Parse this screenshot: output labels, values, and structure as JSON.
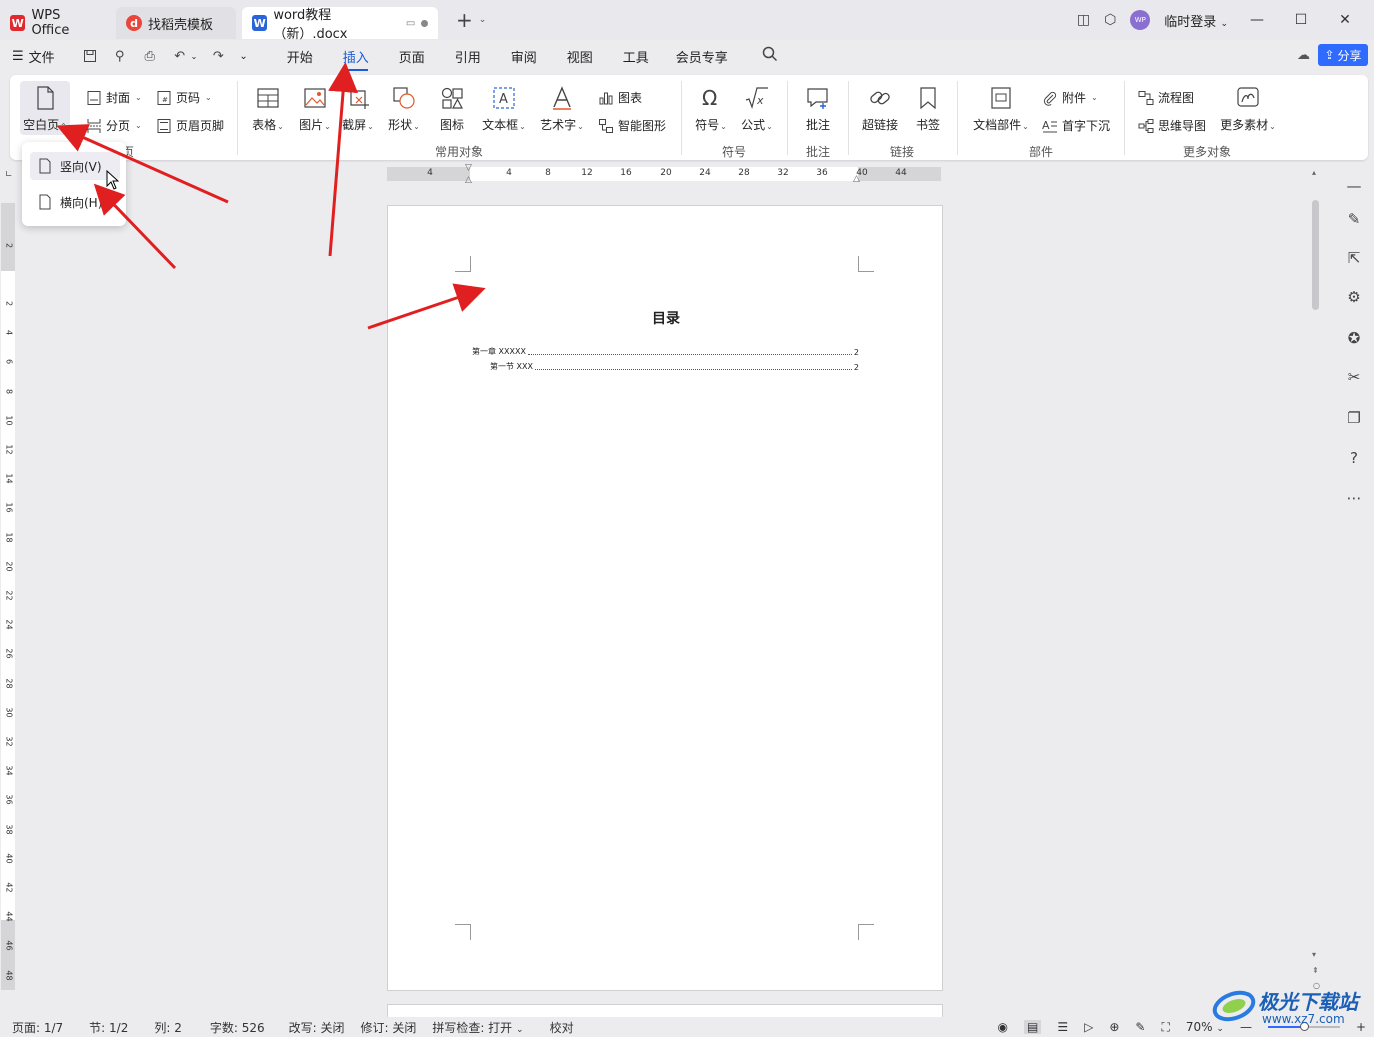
{
  "titlebar": {
    "tabs": [
      {
        "label": "WPS Office"
      },
      {
        "label": "找稻壳模板"
      },
      {
        "label": "word教程（新）.docx"
      }
    ],
    "new_tab": "+",
    "user": "临时登录",
    "avatar_text": "WP"
  },
  "menubar": {
    "file_label": "文件",
    "tabs": [
      "开始",
      "插入",
      "页面",
      "引用",
      "审阅",
      "视图",
      "工具",
      "会员专享"
    ],
    "active_tab": "插入",
    "share_label": "分享"
  },
  "ribbon": {
    "blank_page": "空白页",
    "cover": "封面",
    "page_number": "页码",
    "page_break": "分页",
    "header_footer": "页眉页脚",
    "table": "表格",
    "picture": "图片",
    "screenshot": "截屏",
    "shape": "形状",
    "icon": "图标",
    "textbox": "文本框",
    "wordart": "艺术字",
    "chart": "图表",
    "smart_graphic": "智能图形",
    "symbol": "符号",
    "formula": "公式",
    "comment": "批注",
    "hyperlink": "超链接",
    "bookmark": "书签",
    "doc_parts": "文档部件",
    "attachment": "附件",
    "drop_cap": "首字下沉",
    "flowchart": "流程图",
    "mindmap": "思维导图",
    "more_material": "更多素材",
    "groups": {
      "pages_partial": "页",
      "common_objects": "常用对象",
      "symbols": "符号",
      "comments": "批注",
      "links": "链接",
      "parts": "部件",
      "more_objects": "更多对象"
    }
  },
  "dropdown": {
    "portrait": "竖向(V)",
    "landscape": "横向(H)"
  },
  "hruler_ticks": [
    "4",
    "4",
    "8",
    "12",
    "16",
    "20",
    "24",
    "28",
    "32",
    "36",
    "40",
    "44"
  ],
  "vruler_ticks": [
    "2",
    "2",
    "4",
    "6",
    "8",
    "10",
    "12",
    "14",
    "16",
    "18",
    "20",
    "22",
    "24",
    "26",
    "28",
    "30",
    "32",
    "34",
    "36",
    "38",
    "40",
    "42",
    "44",
    "46",
    "48"
  ],
  "document": {
    "title": "目录",
    "toc": [
      {
        "text": "第一章 XXXXX",
        "page": "2"
      },
      {
        "text": "第一节  XXX",
        "page": "2"
      }
    ]
  },
  "statusbar": {
    "page": "页面: 1/7",
    "section": "节: 1/2",
    "column": "列: 2",
    "wordcount": "字数: 526",
    "revision_mode": "改写: 关闭",
    "track_changes": "修订: 关闭",
    "spellcheck": "拼写检查: 打开",
    "proofread": "校对",
    "zoom": "70%",
    "zoom_level": 0.5
  },
  "watermark": {
    "brand": "极光下载站",
    "url": "www.xz7.com"
  },
  "colors": {
    "accent": "#1a5cd6",
    "share": "#2f6bff",
    "arrow": "#e02020"
  }
}
